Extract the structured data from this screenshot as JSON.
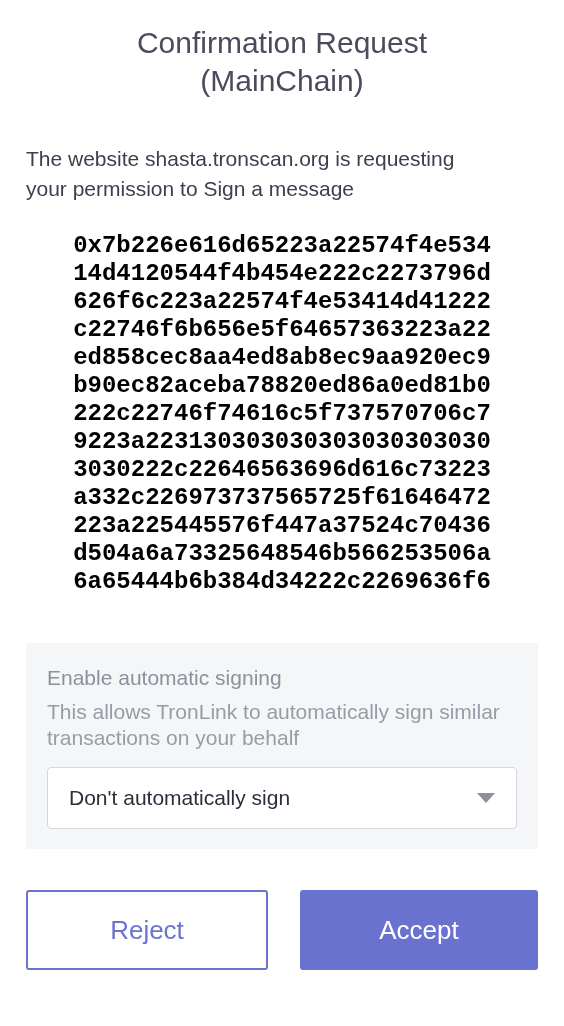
{
  "title": "Confirmation Request (MainChain)",
  "description": "The website shasta.tronscan.org is requesting your permission to Sign a message",
  "message_lines": [
    "0x7b226e616d65223a22574f4e534",
    "14d4120544f4b454e222c2273796d",
    "626f6c223a22574f4e53414d41222",
    "c22746f6b656e5f64657363223a22",
    "ed858cec8aa4ed8ab8ec9aa920ec9",
    "b90ec82aceba78820ed86a0ed81b0",
    "222c22746f74616c5f737570706c7",
    "9223a223130303030303030303030",
    "3030222c22646563696d616c73223",
    "a332c226973737565725f61646472",
    "223a225445576f447a37524c70436",
    "d504a6a73325648546b566253506a",
    "6a65444b6b384d34222c2269636f6"
  ],
  "auto_sign": {
    "title": "Enable automatic signing",
    "hint": "This allows TronLink to automatically sign similar transactions on your behalf",
    "select": {
      "value": "Don't automatically sign"
    }
  },
  "buttons": [
    {
      "kind": "secondary",
      "label": "Reject"
    },
    {
      "kind": "primary",
      "label": "Accept"
    }
  ]
}
